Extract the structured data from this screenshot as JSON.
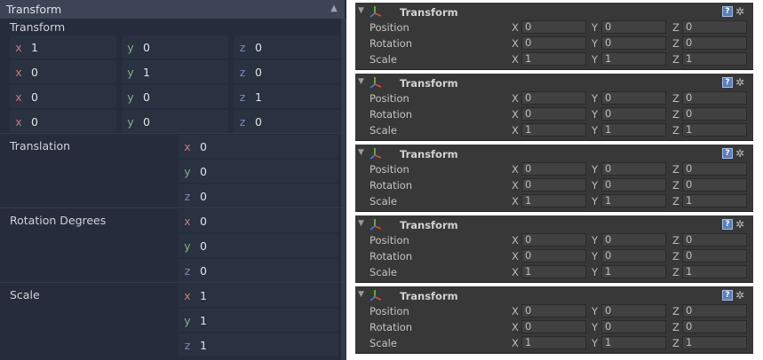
{
  "godot": {
    "header_title": "Transform",
    "section_label": "Transform",
    "matrix_rows": [
      {
        "x": "1",
        "y": "0",
        "z": "0"
      },
      {
        "x": "0",
        "y": "1",
        "z": "0"
      },
      {
        "x": "0",
        "y": "0",
        "z": "1"
      },
      {
        "x": "0",
        "y": "0",
        "z": "0"
      }
    ],
    "axis_labels": {
      "x": "x",
      "y": "y",
      "z": "z"
    },
    "properties": [
      {
        "label": "Translation",
        "x": "0",
        "y": "0",
        "z": "0"
      },
      {
        "label": "Rotation Degrees",
        "x": "0",
        "y": "0",
        "z": "0"
      },
      {
        "label": "Scale",
        "x": "1",
        "y": "1",
        "z": "1"
      }
    ],
    "colors": {
      "background": "#262c3b",
      "axis_x": "#c47b7f",
      "axis_y": "#85b08a",
      "axis_z": "#7e88c4"
    }
  },
  "unity": {
    "component_title": "Transform",
    "help_glyph": "?",
    "gear_glyph": "✲",
    "axis_labels": {
      "x": "X",
      "y": "Y",
      "z": "Z"
    },
    "panels": [
      {
        "rows": [
          {
            "label": "Position",
            "x": "0",
            "y": "0",
            "z": "0"
          },
          {
            "label": "Rotation",
            "x": "0",
            "y": "0",
            "z": "0"
          },
          {
            "label": "Scale",
            "x": "1",
            "y": "1",
            "z": "1"
          }
        ]
      },
      {
        "rows": [
          {
            "label": "Position",
            "x": "0",
            "y": "0",
            "z": "0"
          },
          {
            "label": "Rotation",
            "x": "0",
            "y": "0",
            "z": "0"
          },
          {
            "label": "Scale",
            "x": "1",
            "y": "1",
            "z": "1"
          }
        ]
      },
      {
        "rows": [
          {
            "label": "Position",
            "x": "0",
            "y": "0",
            "z": "0"
          },
          {
            "label": "Rotation",
            "x": "0",
            "y": "0",
            "z": "0"
          },
          {
            "label": "Scale",
            "x": "1",
            "y": "1",
            "z": "1"
          }
        ]
      },
      {
        "rows": [
          {
            "label": "Position",
            "x": "0",
            "y": "0",
            "z": "0"
          },
          {
            "label": "Rotation",
            "x": "0",
            "y": "0",
            "z": "0"
          },
          {
            "label": "Scale",
            "x": "1",
            "y": "1",
            "z": "1"
          }
        ]
      },
      {
        "rows": [
          {
            "label": "Position",
            "x": "0",
            "y": "0",
            "z": "0"
          },
          {
            "label": "Rotation",
            "x": "0",
            "y": "0",
            "z": "0"
          },
          {
            "label": "Scale",
            "x": "1",
            "y": "1",
            "z": "1"
          }
        ]
      }
    ],
    "colors": {
      "panel_bg": "#383838",
      "field_bg": "#414141"
    }
  }
}
